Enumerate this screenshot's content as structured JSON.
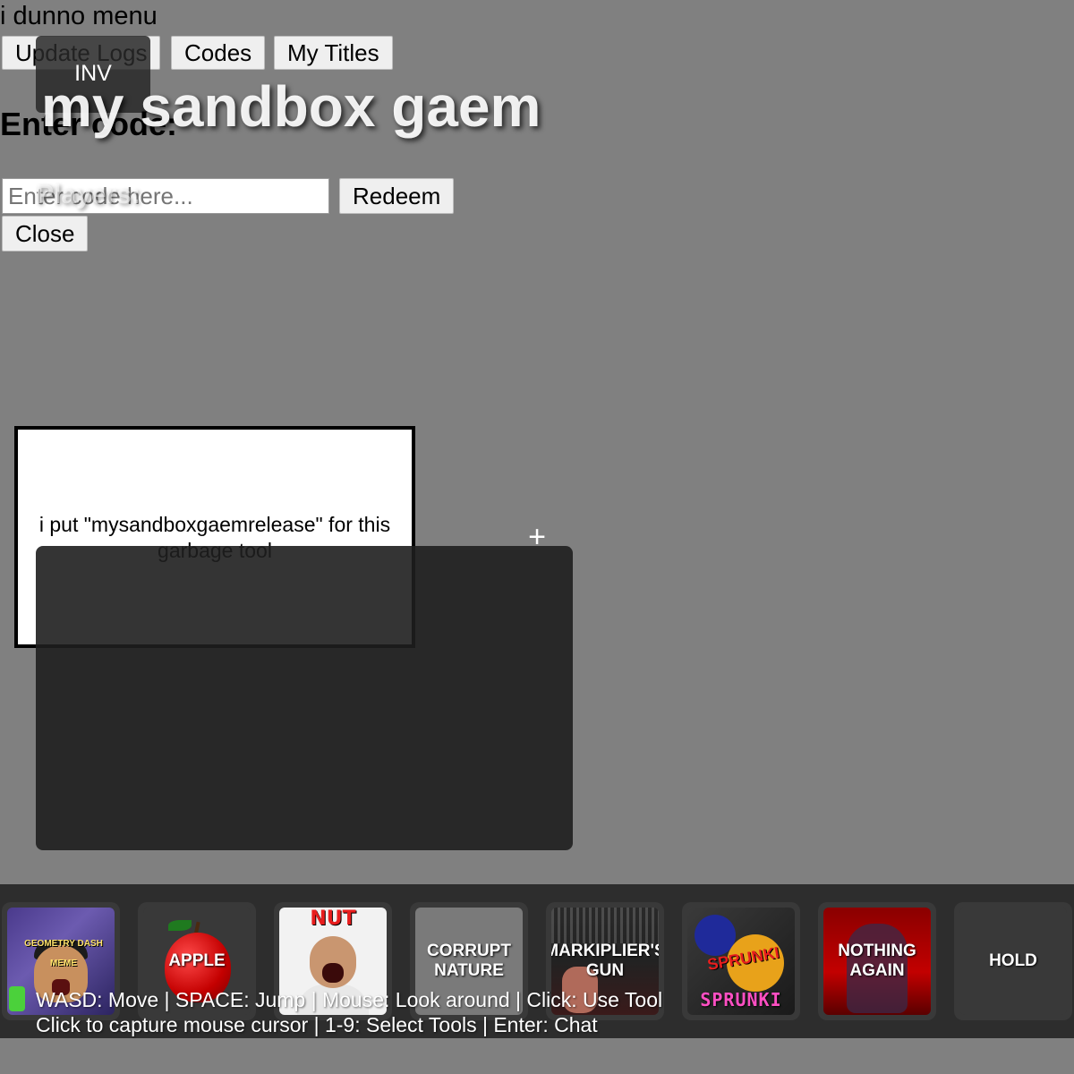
{
  "code_menu": {
    "title": "i dunno menu",
    "buttons": {
      "update_logs": "Update Logs",
      "codes": "Codes",
      "my_titles": "My Titles"
    },
    "enter_code_label": "Enter code:",
    "input_placeholder": "Enter code here...",
    "redeem_label": "Redeem",
    "close_label": "Close"
  },
  "hud": {
    "inv_label": "INV",
    "game_title": "my sandbox gaem",
    "players_label": "Players:",
    "crosshair": "+"
  },
  "tool_card": {
    "description": "i put \"mysandboxgaemrelease\" for this garbage tool"
  },
  "hotbar": {
    "slots": [
      {
        "label": "",
        "art_text": "GEOMETRY DASH MEME",
        "icon": "geometry-dash-meme"
      },
      {
        "label": "APPLE",
        "icon": "apple"
      },
      {
        "label": "",
        "art_text": "NUT",
        "icon": "the-nut"
      },
      {
        "label": "CORRUPT NATURE",
        "icon": "corrupt-nature"
      },
      {
        "label": "MARKIPLIER'S GUN",
        "icon": "markiplier-gun"
      },
      {
        "label": "",
        "art_text_top": "SPRUNKI",
        "art_text_bottom": "SPRUNKI",
        "icon": "sprunki"
      },
      {
        "label": "NOTHING AGAIN",
        "icon": "nothing-again"
      },
      {
        "label": "HOLD",
        "icon": "hold"
      }
    ]
  },
  "controls": {
    "line1": "WASD: Move | SPACE: Jump | Mouse: Look around | Click: Use Tool",
    "line2": "Click to capture mouse cursor | 1-9: Select Tools | Enter: Chat"
  }
}
